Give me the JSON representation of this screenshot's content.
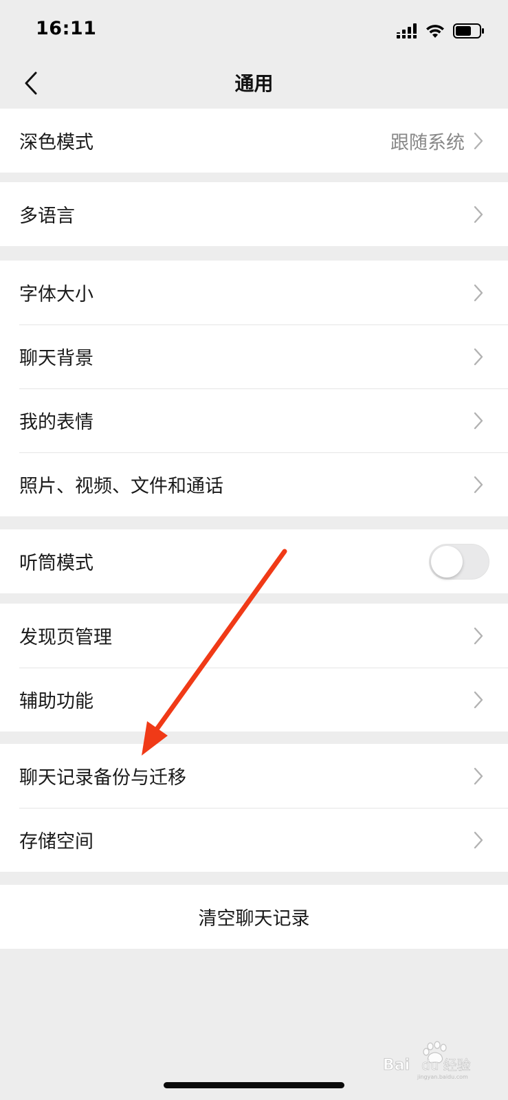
{
  "status_bar": {
    "time": "16:11",
    "icons": [
      "signal-icon",
      "wifi-icon",
      "battery-icon"
    ]
  },
  "nav": {
    "title": "通用",
    "back_icon": "chevron-left-icon"
  },
  "groups": [
    {
      "rows": [
        {
          "label": "深色模式",
          "value": "跟随系统"
        }
      ]
    },
    {
      "rows": [
        {
          "label": "多语言"
        }
      ]
    },
    {
      "rows": [
        {
          "label": "字体大小"
        },
        {
          "label": "聊天背景"
        },
        {
          "label": "我的表情"
        },
        {
          "label": "照片、视频、文件和通话"
        }
      ]
    },
    {
      "rows": [
        {
          "label": "听筒模式",
          "toggle": false
        }
      ]
    },
    {
      "rows": [
        {
          "label": "发现页管理"
        },
        {
          "label": "辅助功能"
        }
      ]
    },
    {
      "rows": [
        {
          "label": "聊天记录备份与迁移"
        },
        {
          "label": "存储空间"
        }
      ]
    },
    {
      "rows": [
        {
          "label": "清空聊天记录"
        }
      ]
    }
  ],
  "watermark": {
    "text": "Baidu经验",
    "url": "jingyan.baidu.com"
  },
  "colors": {
    "background": "#ededed",
    "row_background": "#ffffff",
    "annotation_arrow": "#f03a17",
    "secondary_text": "#888888"
  }
}
